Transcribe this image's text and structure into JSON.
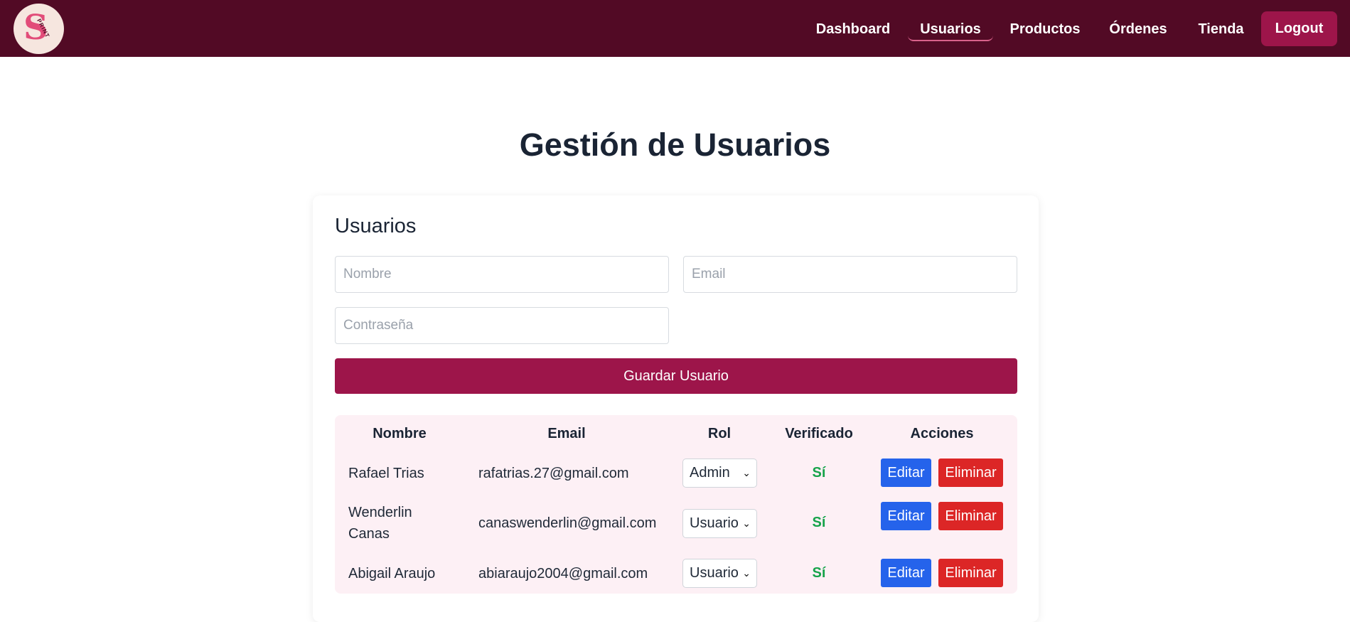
{
  "brand": {
    "logo_letter": "S",
    "logo_word": "PRINT"
  },
  "nav": {
    "items": [
      {
        "label": "Dashboard"
      },
      {
        "label": "Usuarios"
      },
      {
        "label": "Productos"
      },
      {
        "label": "Órdenes"
      },
      {
        "label": "Tienda"
      }
    ],
    "active": "Usuarios",
    "logout_label": "Logout"
  },
  "page": {
    "title": "Gestión de Usuarios"
  },
  "form": {
    "title": "Usuarios",
    "name_placeholder": "Nombre",
    "email_placeholder": "Email",
    "password_placeholder": "Contraseña",
    "save_label": "Guardar Usuario"
  },
  "table": {
    "headers": [
      "Nombre",
      "Email",
      "Rol",
      "Verificado",
      "Acciones"
    ],
    "rows": [
      {
        "name": "Rafael Trias",
        "email": "rafatrias.27@gmail.com",
        "role": "Admin",
        "verified": "Sí",
        "edit_label": "Editar",
        "delete_label": "Eliminar"
      },
      {
        "name": "Wenderlin Canas",
        "email": "canaswenderlin@gmail.com",
        "role": "Usuario",
        "verified": "Sí",
        "edit_label": "Editar",
        "delete_label": "Eliminar"
      },
      {
        "name": "Abigail Araujo",
        "email": "abiaraujo2004@gmail.com",
        "role": "Usuario",
        "verified": "Sí",
        "edit_label": "Editar",
        "delete_label": "Eliminar"
      }
    ]
  },
  "colors": {
    "navbar": "#520a25",
    "accent": "#9d154a",
    "edit_button": "#2563eb",
    "delete_button": "#dc2626",
    "verified": "#16a34a",
    "table_background": "#fdf0f5"
  },
  "icons": {
    "logo": "brand-logo-icon",
    "select": "chevron-down-icon"
  }
}
